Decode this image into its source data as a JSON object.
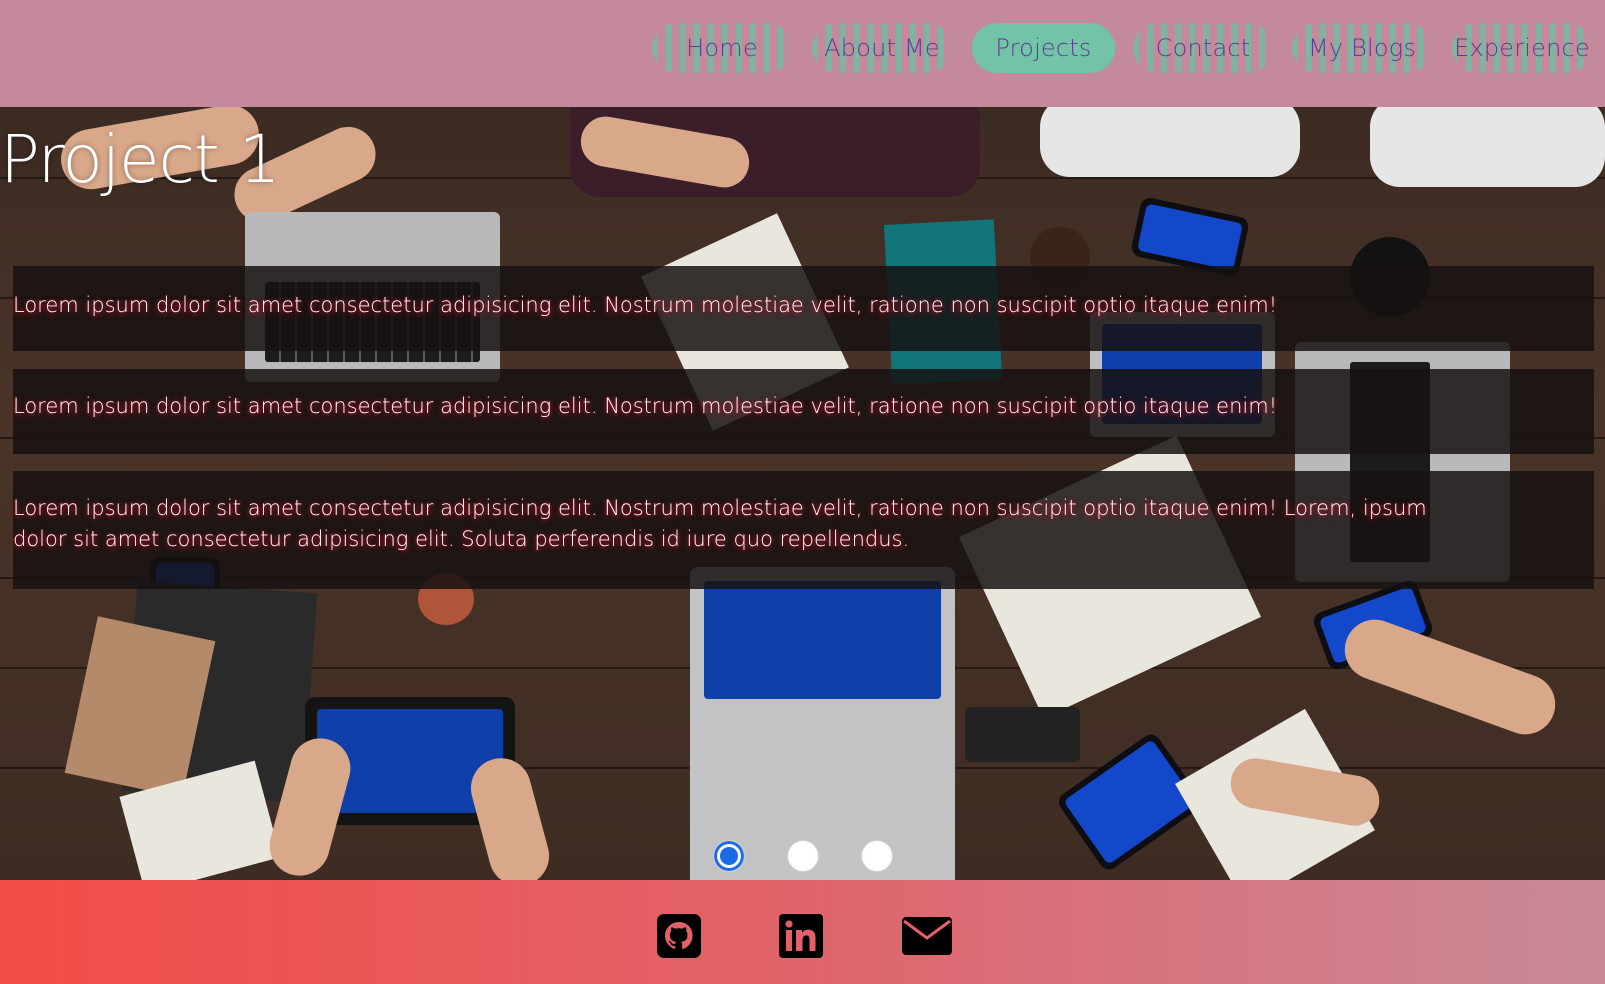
{
  "nav": {
    "items": [
      {
        "label": "Home",
        "active": false
      },
      {
        "label": "About Me",
        "active": false
      },
      {
        "label": "Projects",
        "active": true
      },
      {
        "label": "Contact",
        "active": false
      },
      {
        "label": "My Blogs",
        "active": false
      },
      {
        "label": "Experience",
        "active": false
      }
    ]
  },
  "hero": {
    "title": "Project 1",
    "paragraphs": [
      "Lorem ipsum dolor sit amet consectetur adipisicing elit. Nostrum molestiae velit, ratione non suscipit optio itaque enim!",
      "Lorem ipsum dolor sit amet consectetur adipisicing elit. Nostrum molestiae velit, ratione non suscipit optio itaque enim!",
      "Lorem ipsum dolor sit amet consectetur adipisicing elit. Nostrum molestiae velit, ratione non suscipit optio itaque enim! Lorem, ipsum dolor sit amet consectetur adipisicing elit. Soluta perferendis id iure quo repellendus."
    ],
    "slider": {
      "count": 3,
      "active_index": 0
    }
  },
  "footer": {
    "icons": [
      "github-icon",
      "linkedin-icon",
      "email-icon"
    ]
  },
  "colors": {
    "header_bg": "#c48a9b",
    "nav_active": "#72c3a7",
    "nav_text": "#5c3d8f",
    "footer_start": "#f34c47",
    "footer_end": "#c98a98",
    "text_glow": "#c0102a"
  }
}
